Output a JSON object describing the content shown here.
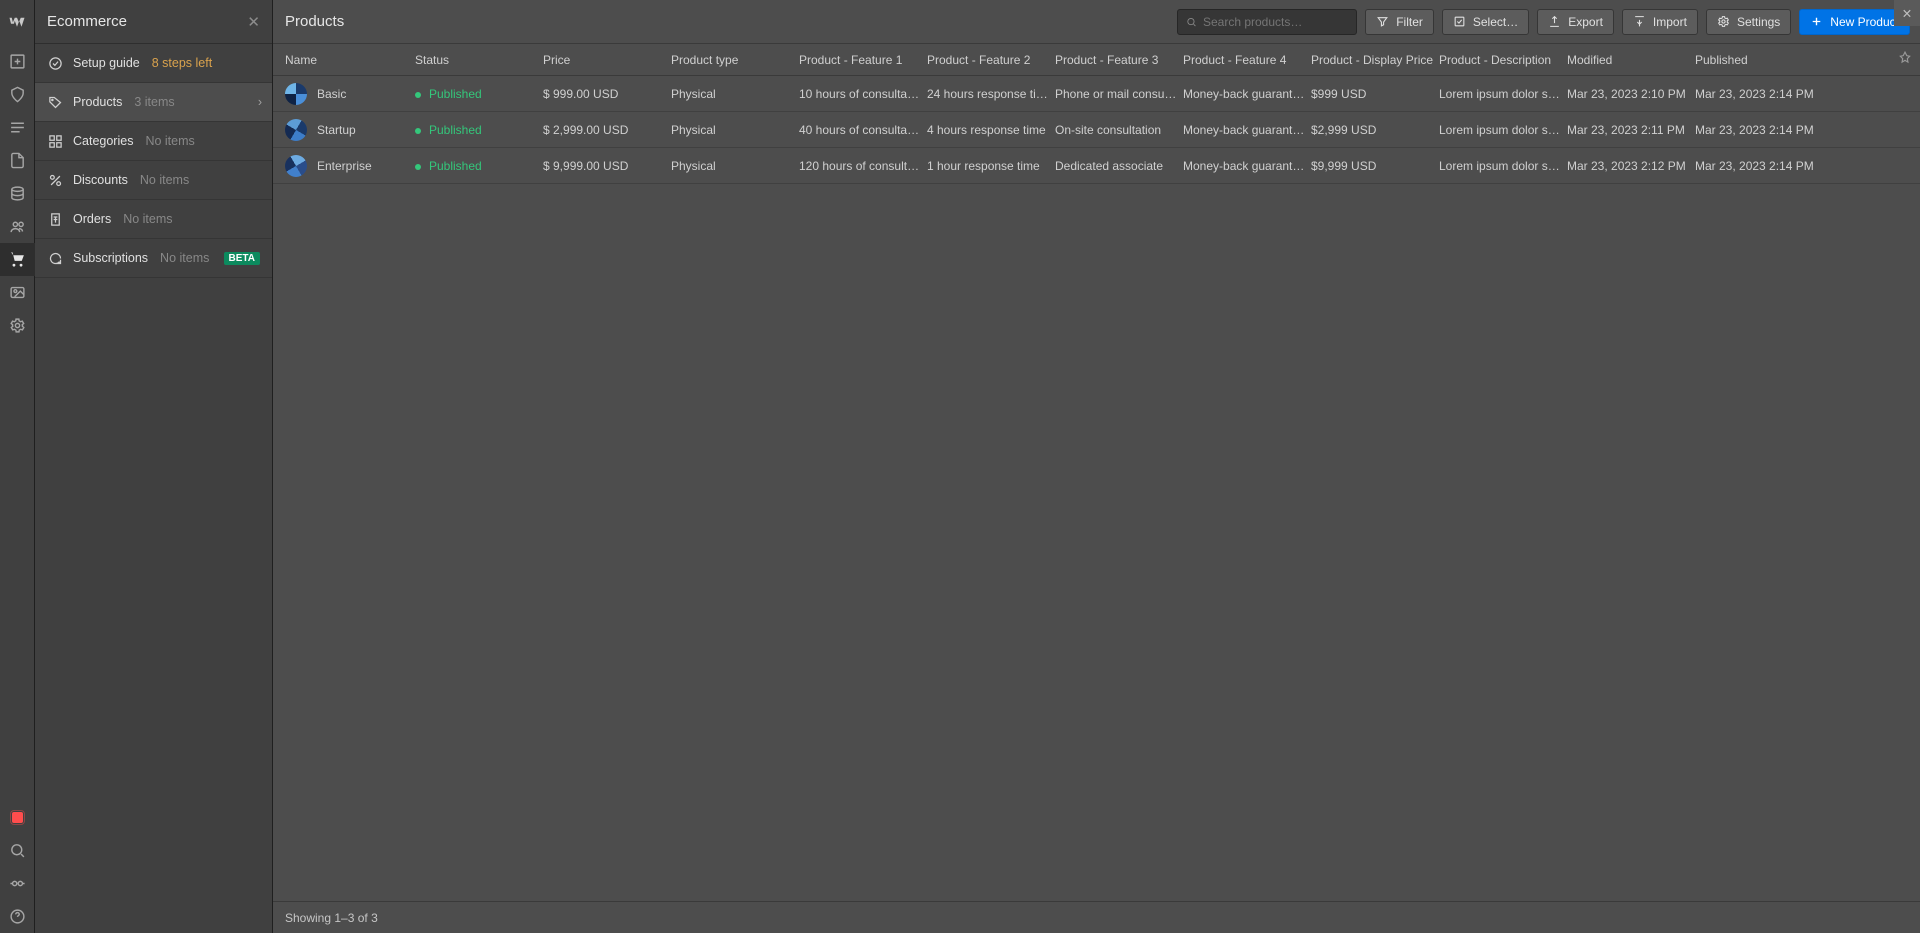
{
  "rail": {
    "items_top": [
      "add",
      "cube",
      "cms",
      "page",
      "collections",
      "users",
      "cart",
      "assets",
      "settings"
    ],
    "items_bottom": [
      "video",
      "search",
      "audit",
      "help"
    ]
  },
  "sidebar": {
    "title": "Ecommerce",
    "items": [
      {
        "icon": "check-circle",
        "label": "Setup guide",
        "meta": "8 steps left",
        "meta_class": "orange"
      },
      {
        "icon": "tag",
        "label": "Products",
        "meta": "3 items",
        "active": true,
        "chevron": true
      },
      {
        "icon": "grid",
        "label": "Categories",
        "meta": "No items"
      },
      {
        "icon": "percent",
        "label": "Discounts",
        "meta": "No items"
      },
      {
        "icon": "receipt",
        "label": "Orders",
        "meta": "No items"
      },
      {
        "icon": "refresh",
        "label": "Subscriptions",
        "meta": "No items",
        "badge": "BETA"
      }
    ]
  },
  "header": {
    "title": "Products",
    "search_placeholder": "Search products…",
    "buttons": {
      "filter": "Filter",
      "select": "Select…",
      "export": "Export",
      "import": "Import",
      "settings": "Settings",
      "new": "New Product"
    }
  },
  "columns": [
    "Name",
    "Status",
    "Price",
    "Product type",
    "Product - Feature 1",
    "Product - Feature 2",
    "Product - Feature 3",
    "Product - Feature 4",
    "Product - Display Price",
    "Product - Description",
    "Modified",
    "Published"
  ],
  "rows": [
    {
      "name": "Basic",
      "status": "Published",
      "price": "$ 999.00 USD",
      "type": "Physical",
      "f1": "10 hours of consultati…",
      "f2": "24 hours response ti…",
      "f3": "Phone or mail consult…",
      "f4": "Money-back guarantee",
      "dp": "$999 USD",
      "desc": "Lorem ipsum dolor sit…",
      "mod": "Mar 23, 2023 2:10 PM",
      "pub": "Mar 23, 2023 2:14 PM",
      "avatar": "a1"
    },
    {
      "name": "Startup",
      "status": "Published",
      "price": "$ 2,999.00 USD",
      "type": "Physical",
      "f1": "40 hours of consultat…",
      "f2": "4 hours response time",
      "f3": "On-site consultation",
      "f4": "Money-back guarantee",
      "dp": "$2,999 USD",
      "desc": "Lorem ipsum dolor sit…",
      "mod": "Mar 23, 2023 2:11 PM",
      "pub": "Mar 23, 2023 2:14 PM",
      "avatar": "a2"
    },
    {
      "name": "Enterprise",
      "status": "Published",
      "price": "$ 9,999.00 USD",
      "type": "Physical",
      "f1": "120 hours of consulta…",
      "f2": "1 hour response time",
      "f3": "Dedicated associate",
      "f4": "Money-back guarantee",
      "dp": "$9,999 USD",
      "desc": "Lorem ipsum dolor sit…",
      "mod": "Mar 23, 2023 2:12 PM",
      "pub": "Mar 23, 2023 2:14 PM",
      "avatar": "a3"
    }
  ],
  "footer": {
    "showing": "Showing 1–3 of 3"
  }
}
